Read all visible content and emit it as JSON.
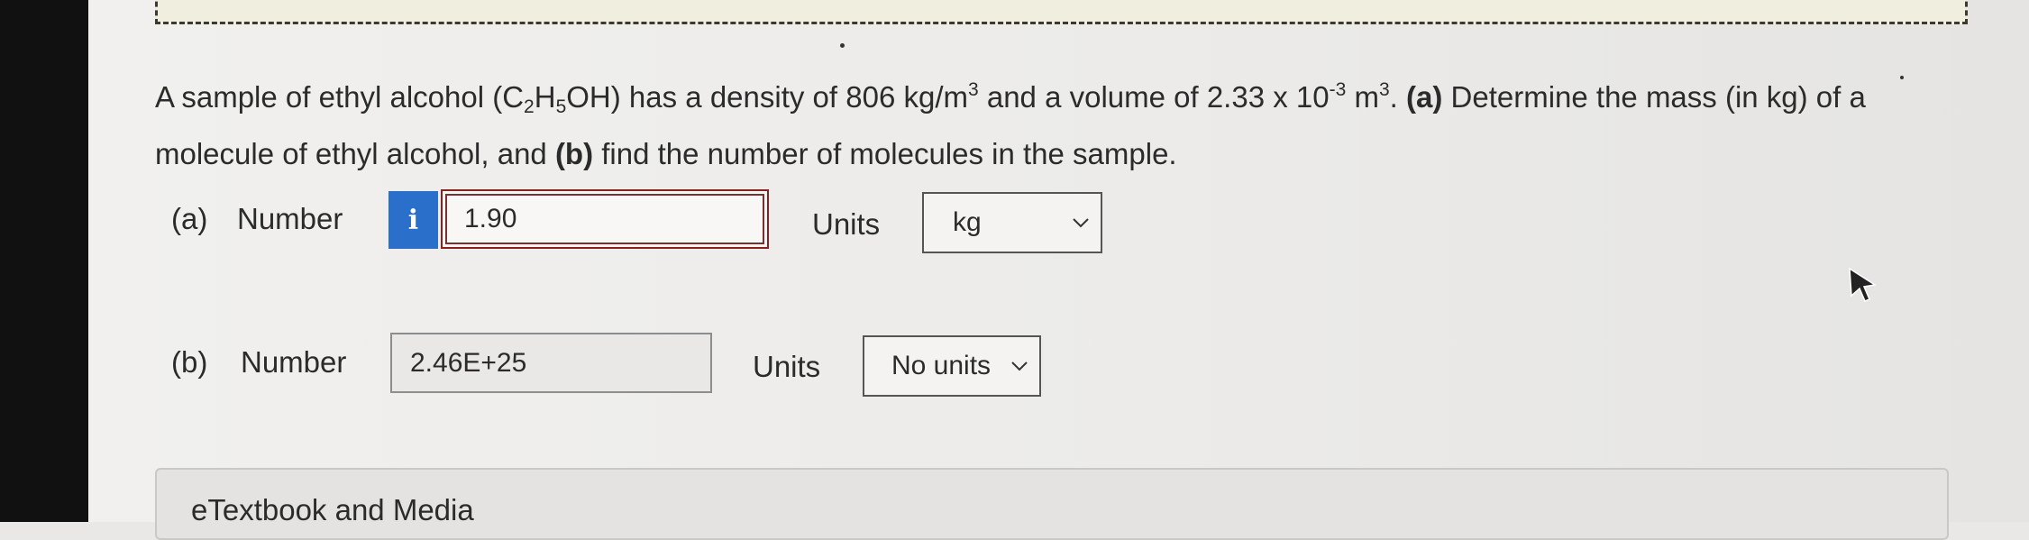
{
  "question": {
    "p1": "A sample of ethyl alcohol (C",
    "sub1": "2",
    "p2": "H",
    "sub2": "5",
    "p3": "OH) has a density of 806 kg/m",
    "sup1": "3",
    "p4": " and a volume of 2.33 x 10",
    "sup2": "-3",
    "p5": " m",
    "sup3": "3",
    "p6": ". ",
    "bold_a": "(a)",
    "p7": " Determine the mass (in kg) of a molecule of ethyl alcohol, and ",
    "bold_b": "(b)",
    "p8": " find the number of molecules in the sample."
  },
  "part_a": {
    "label": "(a)",
    "number_label": "Number",
    "info_glyph": "i",
    "value": "1.90",
    "units_label": "Units",
    "units_value": "kg"
  },
  "part_b": {
    "label": "(b)",
    "number_label": "Number",
    "value": "2.46E+25",
    "units_label": "Units",
    "units_value": "No units"
  },
  "etextbook": {
    "label": "eTextbook and Media"
  },
  "icons": {
    "info": "info-icon",
    "dropdown": "chevron-down-icon",
    "cursor": "mouse-pointer-icon"
  }
}
